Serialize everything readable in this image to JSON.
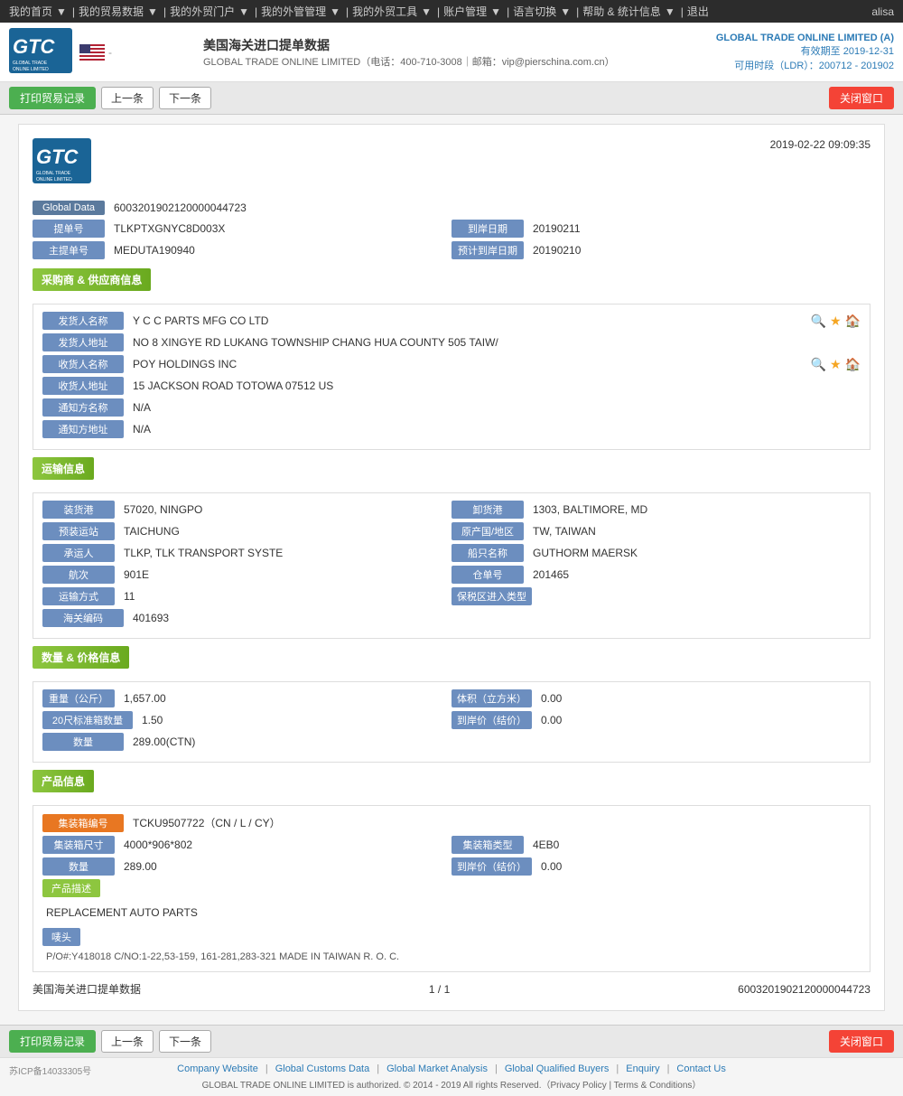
{
  "nav": {
    "items": [
      {
        "label": "我的首页",
        "has_dropdown": false
      },
      {
        "label": "我的贸易数据",
        "has_dropdown": true
      },
      {
        "label": "我的外贸门户",
        "has_dropdown": true
      },
      {
        "label": "我的外管管理",
        "has_dropdown": true
      },
      {
        "label": "我的外贸工具",
        "has_dropdown": true
      },
      {
        "label": "账户管理",
        "has_dropdown": true
      },
      {
        "label": "语言切换",
        "has_dropdown": true
      },
      {
        "label": "帮助 & 统计信息",
        "has_dropdown": true
      },
      {
        "label": "退出",
        "has_dropdown": false
      }
    ],
    "user": "alisa"
  },
  "header": {
    "logo_line1": "GTC",
    "logo_line2": "GLOBAL TRADE ONLINE",
    "title": "美国海关进口提单数据",
    "company": "GLOBAL TRADE ONLINE LIMITED（电话：400-710-3008｜邮箱：vip@pierschina.com.cn）",
    "right_company": "GLOBAL TRADE ONLINE LIMITED (A)",
    "valid_to": "有效期至 2019-12-31",
    "ldr": "可用时段（LDR）：200712 - 201902"
  },
  "toolbar": {
    "print_btn": "打印贸易记录",
    "prev_btn": "上一条",
    "next_btn": "下一条",
    "close_btn": "关闭窗口"
  },
  "doc": {
    "datetime": "2019-02-22 09:09:35",
    "global_data_label": "Global Data",
    "global_data_value": "6003201902120000044723",
    "bill_no_label": "提单号",
    "bill_no_value": "TLKPTXGNYC8D003X",
    "arrival_date_label": "到岸日期",
    "arrival_date_value": "20190211",
    "master_bill_label": "主提单号",
    "master_bill_value": "MEDUTA190940",
    "estimated_date_label": "预计到岸日期",
    "estimated_date_value": "20190210"
  },
  "shipper": {
    "section_title": "采购商 & 供应商信息",
    "shipper_name_label": "发货人名称",
    "shipper_name_value": "Y C C PARTS MFG CO LTD",
    "shipper_addr_label": "发货人地址",
    "shipper_addr_value": "NO 8 XINGYE RD LUKANG TOWNSHIP CHANG HUA COUNTY 505 TAIW/",
    "consignee_name_label": "收货人名称",
    "consignee_name_value": "POY HOLDINGS INC",
    "consignee_addr_label": "收货人地址",
    "consignee_addr_value": "15 JACKSON ROAD TOTOWA 07512 US",
    "notify_name_label": "通知方名称",
    "notify_name_value": "N/A",
    "notify_addr_label": "通知方地址",
    "notify_addr_value": "N/A"
  },
  "transport": {
    "section_title": "运输信息",
    "loading_port_label": "装货港",
    "loading_port_value": "57020, NINGPO",
    "unloading_port_label": "卸货港",
    "unloading_port_value": "1303, BALTIMORE, MD",
    "pre_loading_label": "预装运站",
    "pre_loading_value": "TAICHUNG",
    "origin_label": "原产国/地区",
    "origin_value": "TW, TAIWAN",
    "carrier_label": "承运人",
    "carrier_value": "TLKP, TLK TRANSPORT SYSTE",
    "vessel_label": "船只名称",
    "vessel_value": "GUTHORM MAERSK",
    "flight_label": "航次",
    "flight_value": "901E",
    "container_no_label": "仓单号",
    "container_no_value": "201465",
    "transport_mode_label": "运输方式",
    "transport_mode_value": "11",
    "bonded_label": "保税区进入类型",
    "bonded_value": "",
    "customs_no_label": "海关编码",
    "customs_no_value": "401693"
  },
  "quantity": {
    "section_title": "数量 & 价格信息",
    "weight_label": "重量（公斤）",
    "weight_value": "1,657.00",
    "volume_label": "体积（立方米）",
    "volume_value": "0.00",
    "container20_label": "20尺标准箱数量",
    "container20_value": "1.50",
    "arrival_price_label": "到岸价（结价）",
    "arrival_price_value": "0.00",
    "quantity_label": "数量",
    "quantity_value": "289.00(CTN)"
  },
  "product": {
    "section_title": "产品信息",
    "container_no_label": "集装箱编号",
    "container_no_value": "TCKU9507722（CN / L / CY）",
    "container_size_label": "集装箱尺寸",
    "container_size_value": "4000*906*802",
    "container_type_label": "集装箱类型",
    "container_type_value": "4EB0",
    "quantity_label": "数量",
    "quantity_value": "289.00",
    "arrival_price_label": "到岸价（结价）",
    "arrival_price_value": "0.00",
    "desc_label": "产品描述",
    "desc_value": "REPLACEMENT AUTO PARTS",
    "marks_label": "唛头",
    "marks_value": "P/O#:Y418018 C/NO:1-22,53-159, 161-281,283-321 MADE IN TAIWAN R. O. C."
  },
  "page": {
    "data_label": "美国海关进口提单数据",
    "page_info": "1 / 1",
    "doc_no": "6003201902120000044723"
  },
  "footer": {
    "icp": "苏ICP备14033305号",
    "links": [
      "Company Website",
      "Global Customs Data",
      "Global Market Analysis",
      "Global Qualified Buyers",
      "Enquiry",
      "Contact Us"
    ],
    "copyright": "GLOBAL TRADE ONLINE LIMITED is authorized. © 2014 - 2019 All rights Reserved.（Privacy Policy | Terms & Conditions）"
  }
}
